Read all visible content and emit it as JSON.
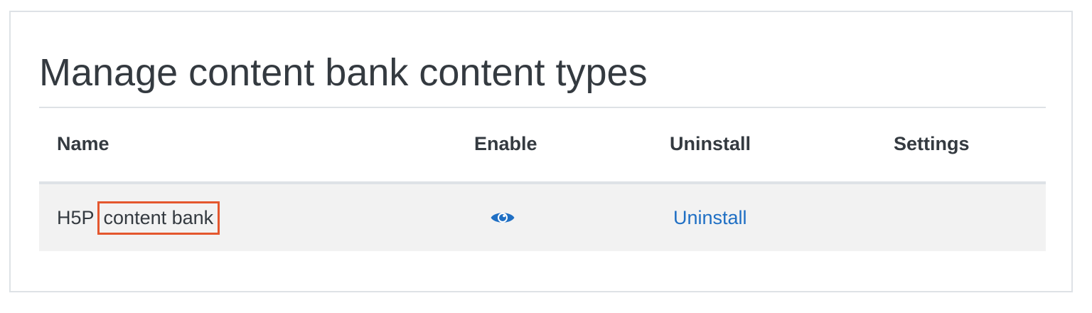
{
  "page": {
    "title": "Manage content bank content types"
  },
  "table": {
    "headers": {
      "name": "Name",
      "enable": "Enable",
      "uninstall": "Uninstall",
      "settings": "Settings"
    },
    "rows": [
      {
        "name_prefix": "H5P",
        "name_highlight": "content bank",
        "enable_icon": "eye-icon",
        "enabled": true,
        "uninstall_label": "Uninstall",
        "settings": ""
      }
    ]
  },
  "colors": {
    "link": "#1f6fc4",
    "highlight_border": "#e4572e",
    "row_background": "#f2f2f2",
    "text": "#343a40",
    "border": "#dee2e6"
  }
}
